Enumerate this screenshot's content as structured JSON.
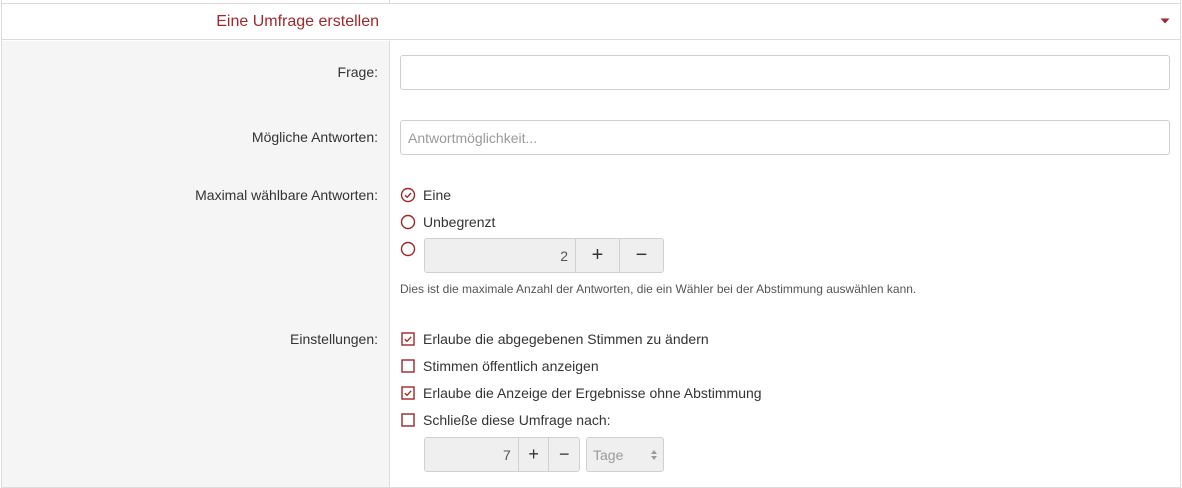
{
  "header": {
    "title": "Eine Umfrage erstellen",
    "caret_icon": "caret-down-icon",
    "accent_color": "#a0282a"
  },
  "question": {
    "label": "Frage:",
    "value": "",
    "placeholder": ""
  },
  "answers": {
    "label": "Mögliche Antworten:",
    "value": "",
    "placeholder": "Antwortmöglichkeit..."
  },
  "max_answers": {
    "label": "Maximal wählbare Antworten:",
    "options": [
      {
        "label": "Eine",
        "selected": true
      },
      {
        "label": "Unbegrenzt",
        "selected": false
      },
      {
        "label": "",
        "selected": false
      }
    ],
    "custom_value": "2",
    "plus": "+",
    "minus": "−",
    "help": "Dies ist die maximale Anzahl der Antworten, die ein Wähler bei der Abstimmung auswählen kann."
  },
  "settings": {
    "label": "Einstellungen:",
    "items": [
      {
        "label": "Erlaube die abgegebenen Stimmen zu ändern",
        "checked": true
      },
      {
        "label": "Stimmen öffentlich anzeigen",
        "checked": false
      },
      {
        "label": "Erlaube die Anzeige der Ergebnisse ohne Abstimmung",
        "checked": true
      },
      {
        "label": "Schließe diese Umfrage nach:",
        "checked": false
      }
    ],
    "close_after_value": "7",
    "plus": "+",
    "minus": "−",
    "unit_select": "Tage"
  }
}
